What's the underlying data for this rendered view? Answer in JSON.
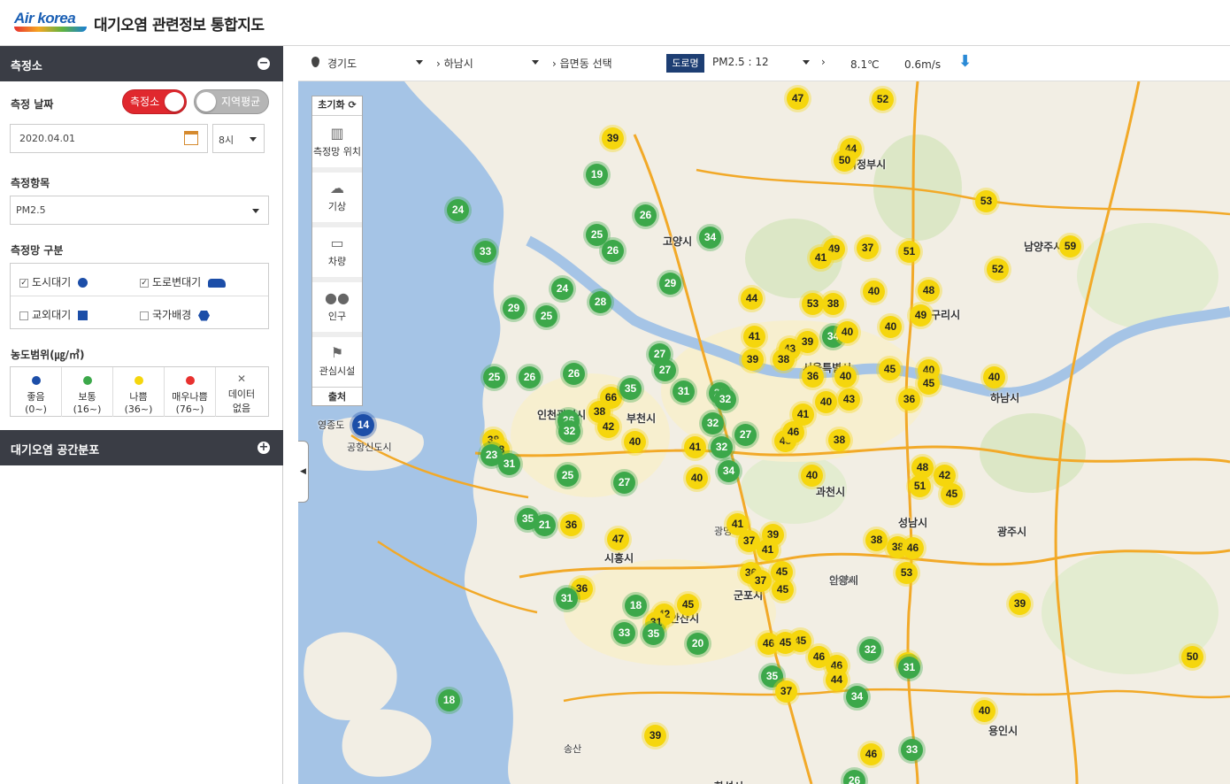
{
  "header": {
    "logo_text": "Air korea",
    "title": "대기오염 관련정보 통합지도"
  },
  "sidebar": {
    "station_section": "측정소",
    "date_label": "측정 날짜",
    "toggle_on": "측정소",
    "toggle_off": "지역평균",
    "date_value": "2020.04.01",
    "hour_value": "8시",
    "item_label": "측정항목",
    "item_value": "PM2.5",
    "network_label": "측정망 구분",
    "networks": [
      "도시대기",
      "도로변대기",
      "교외대기",
      "국가배경"
    ],
    "range_label": "농도범위(㎍/㎥)",
    "legend": [
      {
        "label": "좋음",
        "range": "(0~)",
        "color": "#1c4ea8"
      },
      {
        "label": "보통",
        "range": "(16~)",
        "color": "#3ca84a"
      },
      {
        "label": "나쁨",
        "range": "(36~)",
        "color": "#f5d60d"
      },
      {
        "label": "매우나쁨",
        "range": "(76~)",
        "color": "#e8312f"
      },
      {
        "label": "데이터",
        "range": "없음",
        "color": ""
      }
    ],
    "distribution_section": "대기오염 공간분포"
  },
  "toolbar": {
    "province": "경기도",
    "city": "하남시",
    "town": "읍면동 선택",
    "road_badge": "도로명",
    "pm_reading": "PM2.5 : 12",
    "temperature": "8.1℃",
    "wind": "0.6m/s"
  },
  "tools": {
    "reset": "초기화",
    "items": [
      "측정망 위치",
      "기상",
      "차량",
      "인구",
      "관심시설"
    ],
    "source": "출처"
  },
  "places": [
    "의정부시",
    "고양시",
    "남양주시",
    "구리시",
    "서울특별시",
    "하남시",
    "부천시",
    "인천광역시",
    "광명",
    "과천시",
    "성남시",
    "광주시",
    "시흥시",
    "안양시",
    "의왕시",
    "군포시",
    "안산시",
    "용인시",
    "화성시",
    "영종도",
    "공항신도시",
    "송산"
  ],
  "markers": [
    {
      "v": "47",
      "c": "y"
    },
    {
      "v": "52",
      "c": "y"
    },
    {
      "v": "39",
      "c": "y"
    },
    {
      "v": "44",
      "c": "y"
    },
    {
      "v": "50",
      "c": "y"
    },
    {
      "v": "19",
      "c": "g"
    },
    {
      "v": "24",
      "c": "g"
    },
    {
      "v": "26",
      "c": "g"
    },
    {
      "v": "53",
      "c": "y"
    },
    {
      "v": "25",
      "c": "g"
    },
    {
      "v": "34",
      "c": "g"
    },
    {
      "v": "33",
      "c": "g"
    },
    {
      "v": "26",
      "c": "g"
    },
    {
      "v": "49",
      "c": "y"
    },
    {
      "v": "41",
      "c": "y"
    },
    {
      "v": "37",
      "c": "y"
    },
    {
      "v": "51",
      "c": "y"
    },
    {
      "v": "59",
      "c": "y"
    },
    {
      "v": "52",
      "c": "y"
    },
    {
      "v": "29",
      "c": "g"
    },
    {
      "v": "24",
      "c": "g"
    },
    {
      "v": "48",
      "c": "y"
    },
    {
      "v": "40",
      "c": "y"
    },
    {
      "v": "44",
      "c": "y"
    },
    {
      "v": "53",
      "c": "y"
    },
    {
      "v": "38",
      "c": "y"
    },
    {
      "v": "29",
      "c": "g"
    },
    {
      "v": "25",
      "c": "g"
    },
    {
      "v": "28",
      "c": "g"
    },
    {
      "v": "49",
      "c": "y"
    },
    {
      "v": "41",
      "c": "y"
    },
    {
      "v": "43",
      "c": "y"
    },
    {
      "v": "39",
      "c": "y"
    },
    {
      "v": "34",
      "c": "g"
    },
    {
      "v": "40",
      "c": "y"
    },
    {
      "v": "40",
      "c": "y"
    },
    {
      "v": "39",
      "c": "y"
    },
    {
      "v": "38",
      "c": "y"
    },
    {
      "v": "27",
      "c": "g"
    },
    {
      "v": "27",
      "c": "g"
    },
    {
      "v": "26",
      "c": "g"
    },
    {
      "v": "25",
      "c": "g"
    },
    {
      "v": "26",
      "c": "g"
    },
    {
      "v": "45",
      "c": "y"
    },
    {
      "v": "40",
      "c": "y"
    },
    {
      "v": "36",
      "c": "y"
    },
    {
      "v": "40",
      "c": "y"
    },
    {
      "v": "45",
      "c": "y"
    },
    {
      "v": "40",
      "c": "y"
    },
    {
      "v": "36",
      "c": "y"
    },
    {
      "v": "66",
      "c": "y"
    },
    {
      "v": "35",
      "c": "g"
    },
    {
      "v": "31",
      "c": "g"
    },
    {
      "v": "29",
      "c": "g"
    },
    {
      "v": "32",
      "c": "g"
    },
    {
      "v": "40",
      "c": "y"
    },
    {
      "v": "43",
      "c": "y"
    },
    {
      "v": "26",
      "c": "g"
    },
    {
      "v": "32",
      "c": "g"
    },
    {
      "v": "38",
      "c": "y"
    },
    {
      "v": "42",
      "c": "y"
    },
    {
      "v": "41",
      "c": "y"
    },
    {
      "v": "14",
      "c": "b"
    },
    {
      "v": "38",
      "c": "y"
    },
    {
      "v": "28",
      "c": "y"
    },
    {
      "v": "23",
      "c": "g"
    },
    {
      "v": "31",
      "c": "g"
    },
    {
      "v": "40",
      "c": "y"
    },
    {
      "v": "32",
      "c": "g"
    },
    {
      "v": "27",
      "c": "g"
    },
    {
      "v": "45",
      "c": "y"
    },
    {
      "v": "46",
      "c": "y"
    },
    {
      "v": "38",
      "c": "y"
    },
    {
      "v": "41",
      "c": "y"
    },
    {
      "v": "32",
      "c": "g"
    },
    {
      "v": "34",
      "c": "g"
    },
    {
      "v": "25",
      "c": "g"
    },
    {
      "v": "27",
      "c": "g"
    },
    {
      "v": "40",
      "c": "y"
    },
    {
      "v": "40",
      "c": "y"
    },
    {
      "v": "48",
      "c": "y"
    },
    {
      "v": "42",
      "c": "y"
    },
    {
      "v": "51",
      "c": "y"
    },
    {
      "v": "45",
      "c": "y"
    },
    {
      "v": "35",
      "c": "g"
    },
    {
      "v": "21",
      "c": "g"
    },
    {
      "v": "36",
      "c": "y"
    },
    {
      "v": "47",
      "c": "y"
    },
    {
      "v": "41",
      "c": "y"
    },
    {
      "v": "37",
      "c": "y"
    },
    {
      "v": "39",
      "c": "y"
    },
    {
      "v": "41",
      "c": "y"
    },
    {
      "v": "38",
      "c": "y"
    },
    {
      "v": "38",
      "c": "y"
    },
    {
      "v": "46",
      "c": "y"
    },
    {
      "v": "45",
      "c": "y"
    },
    {
      "v": "36",
      "c": "y"
    },
    {
      "v": "37",
      "c": "y"
    },
    {
      "v": "45",
      "c": "y"
    },
    {
      "v": "53",
      "c": "y"
    },
    {
      "v": "36",
      "c": "y"
    },
    {
      "v": "31",
      "c": "g"
    },
    {
      "v": "18",
      "c": "g"
    },
    {
      "v": "42",
      "c": "y"
    },
    {
      "v": "31",
      "c": "y"
    },
    {
      "v": "45",
      "c": "y"
    },
    {
      "v": "33",
      "c": "g"
    },
    {
      "v": "35",
      "c": "g"
    },
    {
      "v": "20",
      "c": "g"
    },
    {
      "v": "46",
      "c": "y"
    },
    {
      "v": "45",
      "c": "y"
    },
    {
      "v": "45",
      "c": "y"
    },
    {
      "v": "46",
      "c": "y"
    },
    {
      "v": "46",
      "c": "y"
    },
    {
      "v": "32",
      "c": "g"
    },
    {
      "v": "30",
      "c": "y"
    },
    {
      "v": "31",
      "c": "g"
    },
    {
      "v": "39",
      "c": "y"
    },
    {
      "v": "50",
      "c": "y"
    },
    {
      "v": "35",
      "c": "g"
    },
    {
      "v": "44",
      "c": "y"
    },
    {
      "v": "37",
      "c": "y"
    },
    {
      "v": "34",
      "c": "g"
    },
    {
      "v": "18",
      "c": "g"
    },
    {
      "v": "39",
      "c": "y"
    },
    {
      "v": "40",
      "c": "y"
    },
    {
      "v": "46",
      "c": "y"
    },
    {
      "v": "33",
      "c": "g"
    },
    {
      "v": "26",
      "c": "g"
    }
  ]
}
